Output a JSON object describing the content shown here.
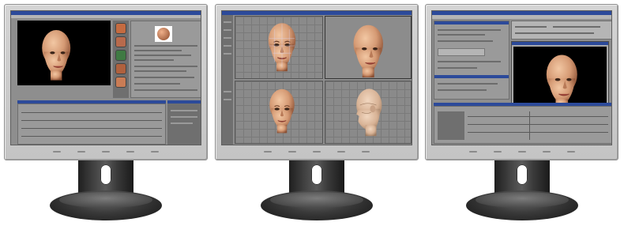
{
  "monitors": [
    {
      "name": "monitor-left",
      "content": "single-viewport-editor"
    },
    {
      "name": "monitor-middle",
      "content": "quad-viewport-editor"
    },
    {
      "name": "monitor-right",
      "content": "render-window-editor"
    }
  ],
  "colors": {
    "bezel": "#c8c8c8",
    "stand": "#2a2a2a",
    "title_bar": "#2c4a9a",
    "ui_grey": "#8e8e8e",
    "viewport_black": "#000000",
    "skin": "#d9a37c"
  },
  "icons": [
    "head-render-icon",
    "material-swatch-icon"
  ]
}
